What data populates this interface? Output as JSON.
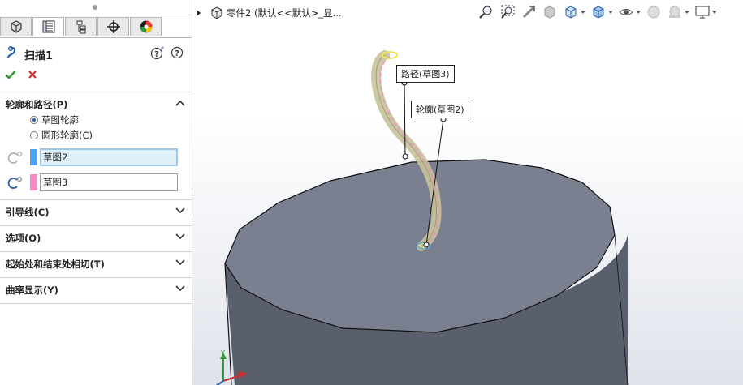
{
  "feature": {
    "title": "扫描1"
  },
  "sections": {
    "profile_path": {
      "label": "轮廓和路径(P)",
      "options": [
        {
          "label": "草图轮廓",
          "selected": true
        },
        {
          "label": "圆形轮廓(C)",
          "selected": false
        }
      ],
      "profile_value": "草图2",
      "path_value": "草图3",
      "profile_color": "#4da3ef",
      "path_color": "#f28bc8"
    },
    "guide_curves": {
      "label": "引导线(C)"
    },
    "options": {
      "label": "选项(O)"
    },
    "tangency": {
      "label": "起始处和结束处相切(T)"
    },
    "curvature": {
      "label": "曲率显示(Y)"
    }
  },
  "tree": {
    "label": "零件2  (默认<<默认>_显..."
  },
  "callouts": {
    "path": "路径(草图3)",
    "profile": "轮廓(草图2)"
  },
  "icons": {
    "tabs": [
      "feature-manager-icon",
      "property-manager-icon",
      "configuration-manager-icon",
      "dimxpert-icon",
      "display-manager-icon"
    ],
    "hud": [
      "zoom-to-fit-icon",
      "zoom-to-area-icon",
      "previous-view-icon",
      "section-view-icon",
      "view-orientation-icon",
      "display-style-icon",
      "hide-show-items-icon",
      "edit-appearance-icon",
      "apply-scene-icon",
      "view-settings-icon"
    ]
  },
  "colors": {
    "cylinder_top": "#7b8091",
    "cylinder_side": "#5a5f6e",
    "accent": "#2a5ea8"
  }
}
